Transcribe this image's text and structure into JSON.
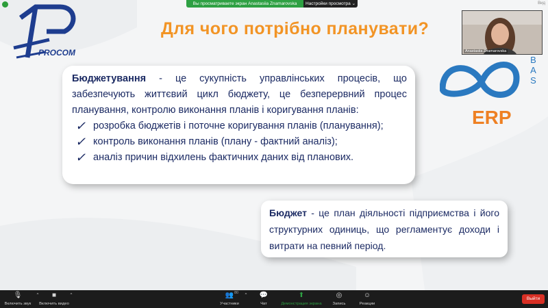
{
  "topbar": {
    "sharing_notice": "Вы просматриваете экран Anastasiia Znamarovska",
    "view_options": "Настройки просмотра ⌄",
    "view_button": "Вид"
  },
  "logo": {
    "brand": "PROCOM"
  },
  "slide": {
    "title": "Для чого потрібно планувати?",
    "card1": {
      "term": "Бюджетування",
      "definition": " - це сукупність управлінських процесів, що забезпечують життєвий цикл бюджету, це безперервний процес планування, контролю виконання планів і коригування планів:",
      "bullets": [
        "розробка бюджетів і поточне коригування планів (планування);",
        "контроль виконання планів (плану - фактний аналіз);",
        "аналіз причин відхилень фактичних даних від планових."
      ]
    },
    "card2": {
      "term": "Бюджет",
      "definition": " - це план діяльності підприємства і його структурних одиниць, що регламентує доходи і витрати на певний період."
    },
    "product": {
      "bas": "BAS",
      "erp": "ERP"
    }
  },
  "video": {
    "participant_name": "Anastasiia Znamarovska"
  },
  "toolbar": {
    "mute_label": "Включить звук",
    "video_label": "Включить видео",
    "participants_label": "Участники",
    "participants_count": "80",
    "chat_label": "Чат",
    "share_label": "Демонстрация экрана",
    "record_label": "Запись",
    "reactions_label": "Реакции",
    "leave_label": "Выйти"
  },
  "colors": {
    "title_orange": "#f29425",
    "text_navy": "#1b2a63",
    "bas_blue": "#2a79c0",
    "erp_orange": "#ee8023",
    "share_green": "#2ea043",
    "leave_red": "#d93025"
  }
}
